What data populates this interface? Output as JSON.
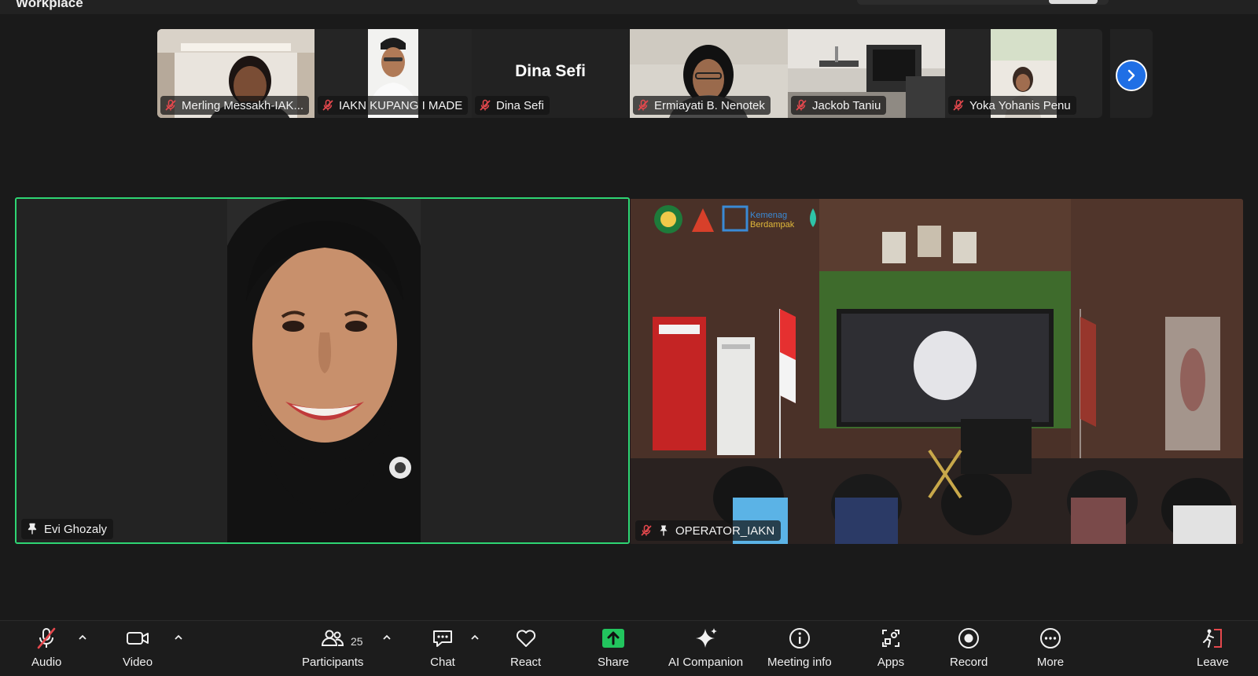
{
  "app": {
    "title": "Workplace"
  },
  "gallery": {
    "tiles": [
      {
        "name": "Merling Messakh-IAK...",
        "muted": true
      },
      {
        "name": "IAKN KUPANG I MADE",
        "muted": true
      },
      {
        "name": "Dina Sefi",
        "muted": true,
        "display_name": "Dina Sefi"
      },
      {
        "name": "Ermiayati B. Nenotek",
        "muted": true
      },
      {
        "name": "Jackob Taniu",
        "muted": true
      },
      {
        "name": "Yoka Yohanis Penu",
        "muted": true
      }
    ]
  },
  "main": {
    "left": {
      "name": "Evi Ghozaly",
      "pinned": true
    },
    "right": {
      "name": "OPERATOR_IAKN",
      "pinned": true,
      "muted": true,
      "logo_text": "Kemenag Berdampak"
    }
  },
  "toolbar": {
    "audio": "Audio",
    "video": "Video",
    "participants": "Participants",
    "participants_count": "25",
    "chat": "Chat",
    "react": "React",
    "share": "Share",
    "ai_companion": "AI Companion",
    "meeting_info": "Meeting info",
    "apps": "Apps",
    "record": "Record",
    "more": "More",
    "leave": "Leave"
  },
  "colors": {
    "active_speaker_border": "#2ed573",
    "share_green": "#22c55e",
    "next_button_blue": "#1f6fe5",
    "mute_red": "#e5484d",
    "leave_red": "#e5484d"
  }
}
